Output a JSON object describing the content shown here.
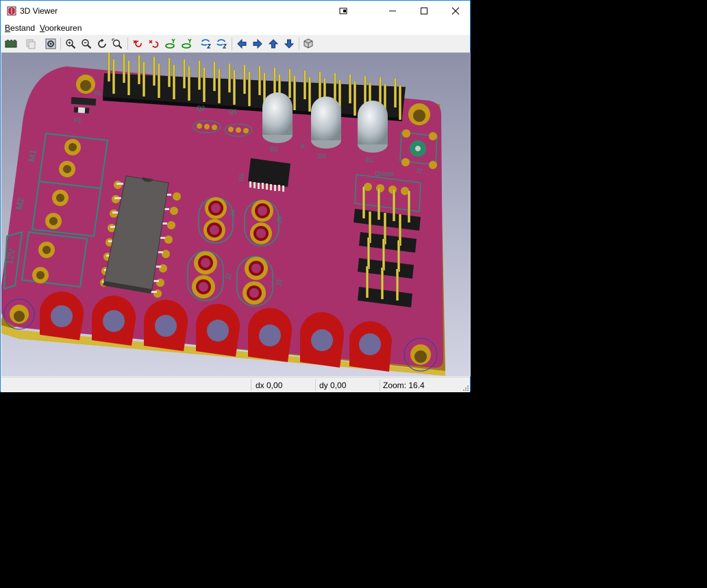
{
  "window": {
    "title": "3D Viewer"
  },
  "menu": {
    "bestand": {
      "accel": "B",
      "rest": "estand"
    },
    "voorkeuren": {
      "accel": "V",
      "rest": "oorkeuren"
    }
  },
  "toolbar": {
    "icons": [
      "render-icon",
      "copy-icon",
      "settings-icon",
      "zoom-in-icon",
      "zoom-out-icon",
      "redraw-icon",
      "zoom-fit-icon",
      "rotate-x-cw-icon",
      "rotate-x-ccw-icon",
      "rotate-y-cw-icon",
      "rotate-y-ccw-icon",
      "rotate-z-cw-icon",
      "rotate-z-ccw-icon",
      "move-left-icon",
      "move-right-icon",
      "move-up-icon",
      "move-down-icon",
      "ortho-icon"
    ]
  },
  "board": {
    "silkscreen": [
      "F1",
      "M1",
      "M2",
      "12V",
      "D2",
      "D3",
      "D1",
      "J4",
      "J5",
      "J2",
      "J3",
      "Q1",
      "Q2",
      "U1",
      "Grove",
      "K",
      "J1",
      "R1"
    ]
  },
  "status": {
    "dx": "dx 0,00",
    "dy": "dy 0,00",
    "zoom": "Zoom: 16.4"
  },
  "colors": {
    "background_top": "#8e91a8",
    "background_bottom": "#d2d4e4",
    "pcb": "#a8316c",
    "copper": "#c49a1a",
    "silkscreen": "#2e8a78",
    "pin_gold": "#d8c22a"
  }
}
